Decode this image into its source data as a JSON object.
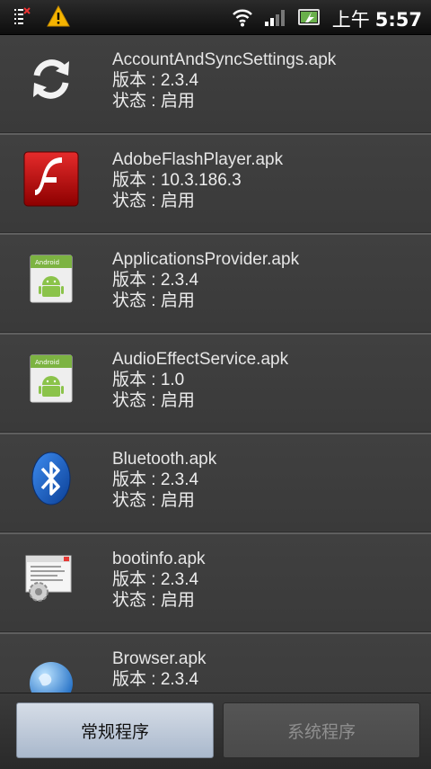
{
  "status_bar": {
    "time_prefix": "上午",
    "time": "5:57",
    "icons": [
      "sim-manager-icon",
      "warning-icon",
      "wifi-icon",
      "signal-icon",
      "battery-charging-icon"
    ]
  },
  "apps": [
    {
      "name": "AccountAndSyncSettings.apk",
      "version": "版本 : 2.3.4",
      "status": "状态 : 启用",
      "icon": "sync-icon"
    },
    {
      "name": "AdobeFlashPlayer.apk",
      "version": "版本 : 10.3.186.3",
      "status": "状态 : 启用",
      "icon": "flash-player-icon"
    },
    {
      "name": "ApplicationsProvider.apk",
      "version": "版本 : 2.3.4",
      "status": "状态 : 启用",
      "icon": "android-app-icon"
    },
    {
      "name": "AudioEffectService.apk",
      "version": "版本 : 1.0",
      "status": "状态 : 启用",
      "icon": "android-app-icon"
    },
    {
      "name": "Bluetooth.apk",
      "version": "版本 : 2.3.4",
      "status": "状态 : 启用",
      "icon": "bluetooth-icon"
    },
    {
      "name": "bootinfo.apk",
      "version": "版本 : 2.3.4",
      "status": "状态 : 启用",
      "icon": "settings-window-icon"
    },
    {
      "name": "Browser.apk",
      "version": "版本 : 2.3.4",
      "status": "",
      "icon": "globe-icon"
    }
  ],
  "tabs": {
    "normal_label": "常规程序",
    "system_label": "系统程序",
    "selected": "常规程序"
  },
  "colors": {
    "background": "#3a3a3a",
    "selected_tab": "#b8c4d4",
    "flash_red": "#c01010",
    "android_green": "#8bc34a",
    "bluetooth_blue": "#1565c0"
  }
}
